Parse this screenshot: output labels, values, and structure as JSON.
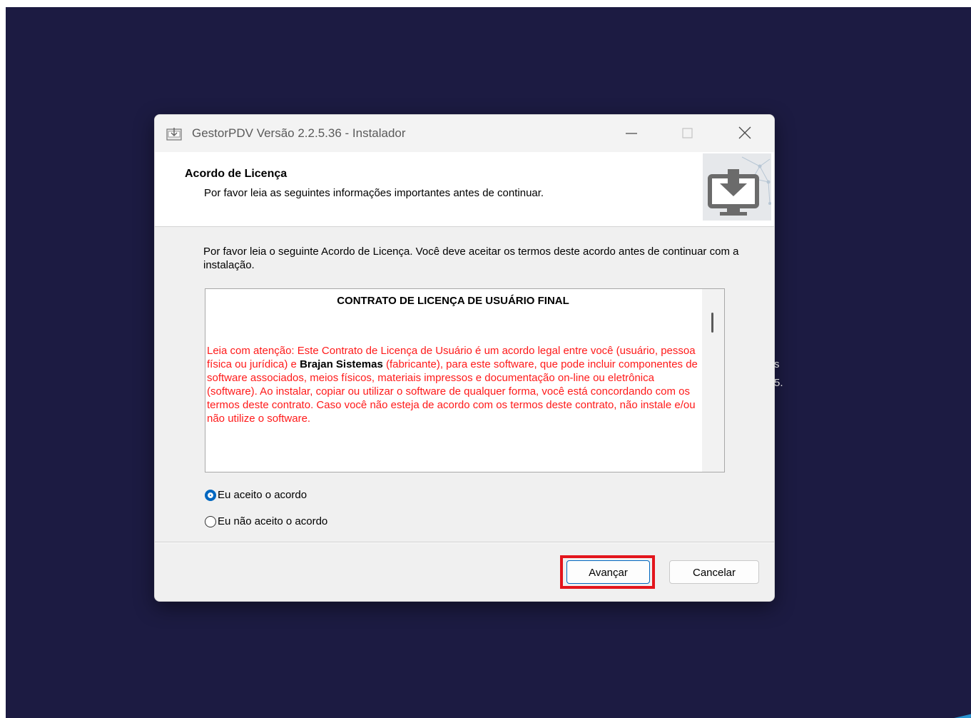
{
  "window": {
    "title": "GestorPDV Versão 2.2.5.36 - Instalador"
  },
  "header": {
    "title": "Acordo de Licença",
    "subtitle": "Por favor leia as seguintes informações importantes antes de continuar."
  },
  "intro_text": "Por favor leia o seguinte Acordo de Licença. Você deve aceitar os termos deste acordo antes de continuar com a instalação.",
  "license": {
    "heading": "CONTRATO DE LICENÇA DE USUÁRIO FINAL",
    "body_part1": "Leia com atenção: Este Contrato de Licença de Usuário é um acordo legal entre você (usuário, pessoa física ou  jurídica) e ",
    "body_bold": "Brajan Sistemas",
    "body_part2": "  (fabricante), para este software, que pode incluir componentes de software associados,  meios físicos, materiais impressos e documentação on-line ou eletrônica (software). Ao instalar, copiar ou utilizar o  software de qualquer forma, você está concordando com os termos deste contrato. Caso você não esteja de acordo com os  termos deste contrato, não instale e/ou não utilize o software."
  },
  "options": {
    "accept_label": "Eu aceito o acordo",
    "decline_label": "Eu não aceito o acordo",
    "selected": "accept"
  },
  "buttons": {
    "next_label": "Avançar",
    "cancel_label": "Cancelar"
  },
  "desktop_glyphs": [
    "s",
    "5."
  ],
  "colors": {
    "desktop_bg": "#1c1b42",
    "license_text": "#ff1a1a",
    "accent": "#0067c0",
    "highlight": "#e3151c"
  },
  "icons": [
    "installer-app-icon",
    "minimize-icon",
    "maximize-icon",
    "close-icon",
    "download-monitor-icon",
    "radio-selected-icon",
    "radio-unselected-icon"
  ]
}
